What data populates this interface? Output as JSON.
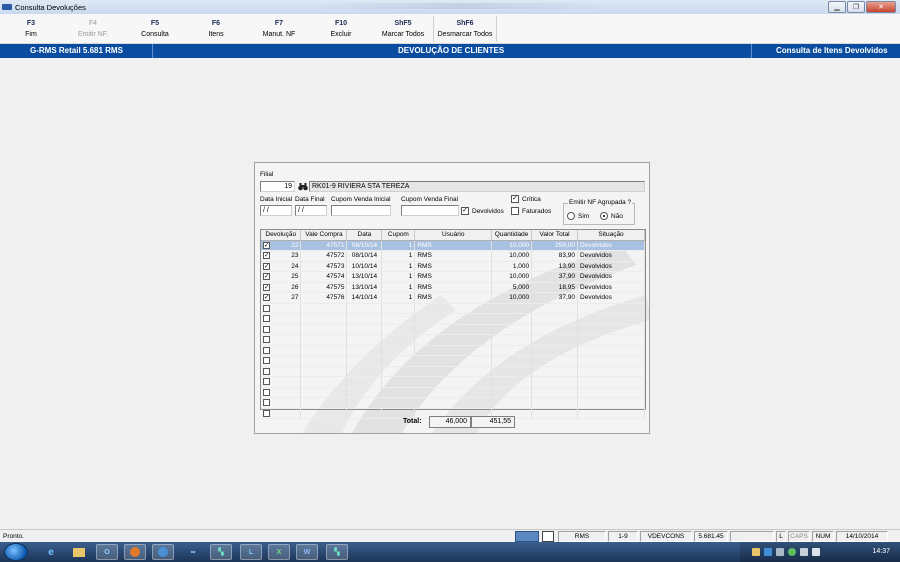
{
  "window": {
    "title": "Consulta Devoluções"
  },
  "toolbar": [
    {
      "key": "F3",
      "label": "Fim",
      "enabled": true
    },
    {
      "key": "F4",
      "label": "Emitir NF.",
      "enabled": false
    },
    {
      "key": "F5",
      "label": "Consulta",
      "enabled": true
    },
    {
      "key": "F6",
      "label": "Itens",
      "enabled": true
    },
    {
      "key": "F7",
      "label": "Manut. NF",
      "enabled": true
    },
    {
      "key": "F10",
      "label": "Excluir",
      "enabled": true
    },
    {
      "key": "ShF5",
      "label": "Marcar Todos",
      "enabled": true
    },
    {
      "key": "ShF6",
      "label": "Desmarcar Todos",
      "enabled": true
    }
  ],
  "header": {
    "left": "G-RMS Retail 5.681 RMS",
    "center": "DEVOLUÇÃO DE CLIENTES",
    "right": "Consulta de Itens Devolvidos"
  },
  "form": {
    "filial_label": "Filial",
    "filial_code": "19",
    "filial_name": "RK01-9 RIVIERA STA TEREZA",
    "data_inicial_label": "Data Inicial",
    "data_inicial_value": " / /",
    "data_final_label": "Data Final",
    "data_final_value": " / /",
    "cupom_inicial_label": "Cupom Venda Inicial",
    "cupom_final_label": "Cupom Venda Final",
    "devolvidos_label": "Devolvidos",
    "devolvidos_checked": true,
    "critica_label": "Crítica",
    "critica_checked": true,
    "faturados_label": "Faturados",
    "faturados_checked": false,
    "agrupada_title": "Emitir NF Agrupada ?",
    "sim_label": "Sim",
    "nao_label": "Não",
    "agrupada_value": "Não"
  },
  "table": {
    "columns": [
      "Devolução",
      "Vale Compra",
      "Data",
      "Cupom",
      "Usuário",
      "Quantidade",
      "Valor Total",
      "Situação"
    ],
    "rows": [
      {
        "checked": true,
        "devolucao": "22",
        "vale": "47571",
        "data": "08/10/14",
        "cupom": "1",
        "usuario": "RMS",
        "qtd": "10,000",
        "valor": "259,00",
        "situacao": "Devolvidos",
        "selected": true
      },
      {
        "checked": true,
        "devolucao": "23",
        "vale": "47572",
        "data": "08/10/14",
        "cupom": "1",
        "usuario": "RMS",
        "qtd": "10,000",
        "valor": "83,90",
        "situacao": "Devolvidos",
        "selected": false
      },
      {
        "checked": true,
        "devolucao": "24",
        "vale": "47573",
        "data": "10/10/14",
        "cupom": "1",
        "usuario": "RMS",
        "qtd": "1,000",
        "valor": "13,90",
        "situacao": "Devolvidos",
        "selected": false
      },
      {
        "checked": true,
        "devolucao": "25",
        "vale": "47574",
        "data": "13/10/14",
        "cupom": "1",
        "usuario": "RMS",
        "qtd": "10,000",
        "valor": "37,90",
        "situacao": "Devolvidos",
        "selected": false
      },
      {
        "checked": true,
        "devolucao": "26",
        "vale": "47575",
        "data": "13/10/14",
        "cupom": "1",
        "usuario": "RMS",
        "qtd": "5,000",
        "valor": "18,95",
        "situacao": "Devolvidos",
        "selected": false
      },
      {
        "checked": true,
        "devolucao": "27",
        "vale": "47576",
        "data": "14/10/14",
        "cupom": "1",
        "usuario": "RMS",
        "qtd": "10,000",
        "valor": "37,90",
        "situacao": "Devolvidos",
        "selected": false
      }
    ],
    "empty_rows": 11
  },
  "totals": {
    "label": "Total:",
    "quantidade": "46,000",
    "valor": "451,55"
  },
  "status": {
    "text": "Pronto.",
    "user": "RMS",
    "page": "1-9",
    "program": "VDEVCONS",
    "version": "5.681.45",
    "l": "L",
    "caps": "CAPS",
    "num": "NUM",
    "date": "14/10/2014"
  },
  "taskbar": {
    "time": "14:37"
  }
}
